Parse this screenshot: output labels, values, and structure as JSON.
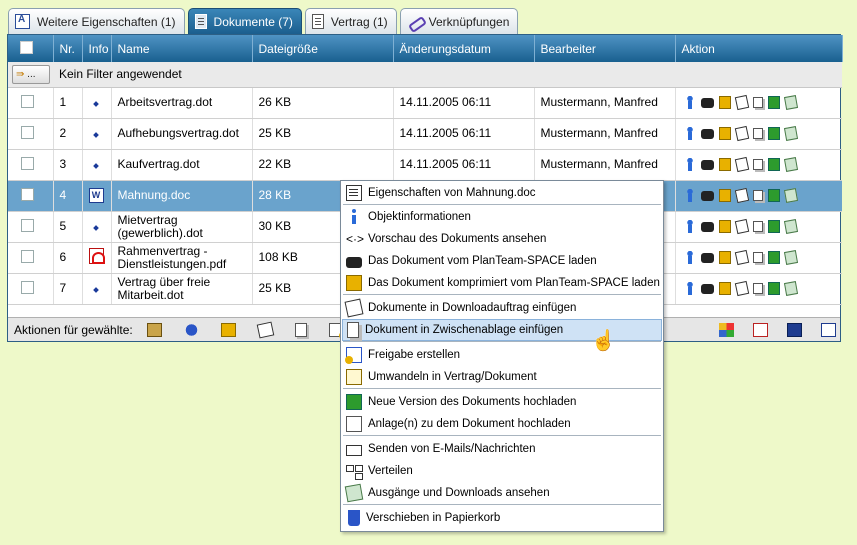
{
  "tabs": [
    {
      "label": "Weitere Eigenschaften",
      "count": "(1)",
      "icon": "properties-icon"
    },
    {
      "label": "Dokumente",
      "count": "(7)",
      "icon": "document-icon",
      "active": true
    },
    {
      "label": "Vertrag",
      "count": "(1)",
      "icon": "contract-icon"
    },
    {
      "label": "Verknüpfungen",
      "count": "",
      "icon": "link-icon"
    }
  ],
  "table": {
    "headers": [
      "Nr.",
      "Info",
      "Name",
      "Dateigröße",
      "Änderungsdatum",
      "Bearbeiter",
      "Aktion"
    ],
    "filter_text": "Kein Filter angewendet",
    "filter_button": "...",
    "rows": [
      {
        "nr": "1",
        "name": "Arbeitsvertrag.dot",
        "size": "26 KB",
        "date": "14.11.2005 06:11",
        "editor": "Mustermann, Manfred",
        "type": "dot"
      },
      {
        "nr": "2",
        "name": "Aufhebungsvertrag.dot",
        "size": "25 KB",
        "date": "14.11.2005 06:11",
        "editor": "Mustermann, Manfred",
        "type": "dot"
      },
      {
        "nr": "3",
        "name": "Kaufvertrag.dot",
        "size": "22 KB",
        "date": "14.11.2005 06:11",
        "editor": "Mustermann, Manfred",
        "type": "dot"
      },
      {
        "nr": "4",
        "name": "Mahnung.doc",
        "size": "28 KB",
        "date": "",
        "editor": "",
        "type": "word",
        "selected": true
      },
      {
        "nr": "5",
        "name": "Mietvertrag (gewerblich).dot",
        "size": "30 KB",
        "date": "",
        "editor": "",
        "type": "dot"
      },
      {
        "nr": "6",
        "name": "Rahmenvertrag - Dienstleistungen.pdf",
        "size": "108 KB",
        "date": "",
        "editor": "",
        "type": "pdf"
      },
      {
        "nr": "7",
        "name": "Vertrag über freie Mitarbeit.dot",
        "size": "25 KB",
        "date": "",
        "editor": "",
        "type": "dot"
      }
    ]
  },
  "footer": {
    "label": "Aktionen für gewählte:"
  },
  "context_menu": {
    "items": [
      {
        "label": "Eigenschaften von Mahnung.doc",
        "icon": "properties-icon"
      },
      {
        "label": "Objektinformationen",
        "icon": "info-icon"
      },
      {
        "label": "Vorschau des Dokuments ansehen",
        "icon": "preview-icon",
        "glyph": "<·>"
      },
      {
        "label": "Das Dokument vom PlanTeam-SPACE laden",
        "icon": "binoculars-icon"
      },
      {
        "label": "Das Dokument komprimiert vom PlanTeam-SPACE laden",
        "icon": "download-compressed-icon"
      },
      {
        "label": "Dokumente in Downloadauftrag einfügen",
        "icon": "download-job-icon"
      },
      {
        "label": "Dokument in Zwischenablage einfügen",
        "icon": "clipboard-icon",
        "highlighted": true
      },
      {
        "label": "Freigabe erstellen",
        "icon": "release-icon"
      },
      {
        "label": "Umwandeln in Vertrag/Dokument",
        "icon": "convert-icon"
      },
      {
        "label": "Neue Version des Dokuments hochladen",
        "icon": "upload-version-icon"
      },
      {
        "label": "Anlage(n) zu dem Dokument hochladen",
        "icon": "attachment-icon"
      },
      {
        "label": "Senden von E-Mails/Nachrichten",
        "icon": "mail-icon"
      },
      {
        "label": "Verteilen",
        "icon": "distribute-icon"
      },
      {
        "label": "Ausgänge und Downloads ansehen",
        "icon": "outbox-icon"
      },
      {
        "label": "Verschieben in Papierkorb",
        "icon": "trash-icon"
      }
    ]
  },
  "colors": {
    "background": "#eef9c9",
    "header": "#19608f",
    "selected_row": "#6aa3cc",
    "menu_highlight": "#cfe2f5"
  }
}
